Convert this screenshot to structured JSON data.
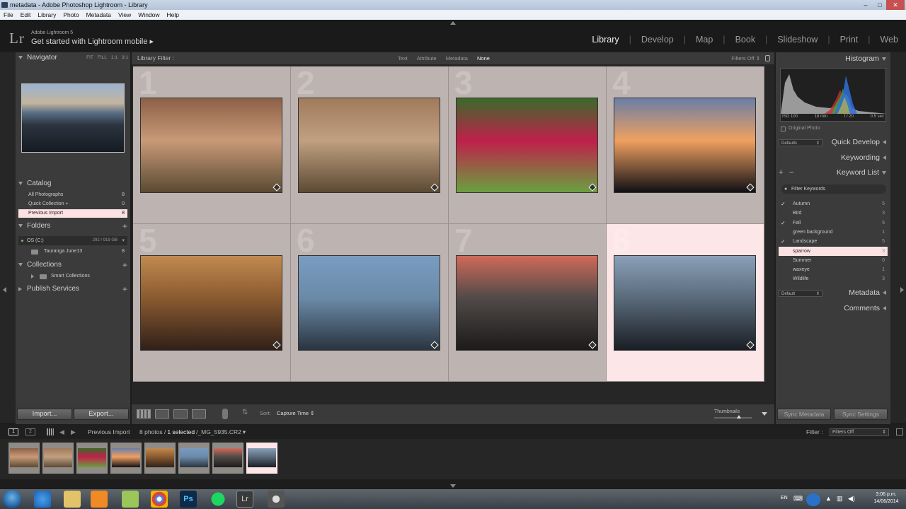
{
  "window": {
    "title": "metadata - Adobe Photoshop Lightroom - Library"
  },
  "menu": [
    "File",
    "Edit",
    "Library",
    "Photo",
    "Metadata",
    "View",
    "Window",
    "Help"
  ],
  "identity": {
    "logo": "Lr",
    "version": "Adobe Lightroom 5",
    "mobile": "Get started with Lightroom mobile"
  },
  "modules": [
    "Library",
    "Develop",
    "Map",
    "Book",
    "Slideshow",
    "Print",
    "Web"
  ],
  "active_module": "Library",
  "navigator": {
    "title": "Navigator",
    "options": [
      "FIT",
      "FILL",
      "1:1",
      "3:1"
    ]
  },
  "catalog": {
    "title": "Catalog",
    "items": [
      {
        "label": "All Photographs",
        "count": "8"
      },
      {
        "label": "Quick Collection +",
        "count": "0"
      },
      {
        "label": "Previous Import",
        "count": "8"
      }
    ]
  },
  "folders": {
    "title": "Folders",
    "drive": "OS (C:)",
    "drive_size": "292 / 919 GB",
    "folder": "Tauranga June13",
    "folder_count": "8"
  },
  "collections": {
    "title": "Collections",
    "item": "Smart Collections"
  },
  "publish": {
    "title": "Publish Services"
  },
  "filter_bar": {
    "label": "Library Filter :",
    "options": [
      "Text",
      "Attribute",
      "Metadata",
      "None"
    ],
    "active": "None",
    "filters_off": "Filters Off"
  },
  "grid": {
    "cells": [
      {
        "num": "1",
        "colors": [
          "#8c6048",
          "#c89a78",
          "#5a4a32"
        ]
      },
      {
        "num": "2",
        "colors": [
          "#a07a5c",
          "#c0a080",
          "#5c4a34"
        ]
      },
      {
        "num": "3",
        "colors": [
          "#3a6a2a",
          "#c0204a",
          "#6aa040"
        ]
      },
      {
        "num": "4",
        "colors": [
          "#6a7ea6",
          "#f0a060",
          "#101014"
        ]
      },
      {
        "num": "5",
        "colors": [
          "#c08a50",
          "#8a5a30",
          "#302018"
        ]
      },
      {
        "num": "6",
        "colors": [
          "#7a9cc0",
          "#6a8aa8",
          "#2a3440"
        ]
      },
      {
        "num": "7",
        "colors": [
          "#d06a5a",
          "#504a48",
          "#1c1a1a"
        ]
      },
      {
        "num": "8",
        "colors": [
          "#8aa0b8",
          "#5a6a7a",
          "#1a1e24"
        ]
      }
    ],
    "selected": 7
  },
  "toolbar": {
    "import": "Import...",
    "export": "Export...",
    "sort_label": "Sort:",
    "sort_value": "Capture Time",
    "thumbnails": "Thumbnails"
  },
  "histogram": {
    "title": "Histogram",
    "iso": "ISO 100",
    "focal": "18 mm",
    "aperture": "f / 20",
    "shutter": "0.5 sec",
    "original": "Original Photo"
  },
  "quick_develop": {
    "title": "Quick Develop",
    "preset": "Defaults"
  },
  "keywording": {
    "title": "Keywording"
  },
  "keyword_list": {
    "title": "Keyword List",
    "filter": "Filter Keywords",
    "items": [
      {
        "label": "Autumn",
        "count": "5",
        "check": "✓"
      },
      {
        "label": "Bird",
        "count": "3",
        "check": ""
      },
      {
        "label": "Fall",
        "count": "5",
        "check": "✓"
      },
      {
        "label": "green background",
        "count": "1",
        "check": ""
      },
      {
        "label": "Landscape",
        "count": "5",
        "check": "✓"
      },
      {
        "label": "sparrow",
        "count": "3",
        "check": ""
      },
      {
        "label": "Summer",
        "count": "0",
        "check": ""
      },
      {
        "label": "waxeye",
        "count": "1",
        "check": ""
      },
      {
        "label": "Wildlife",
        "count": "3",
        "check": ""
      }
    ],
    "selected": 5
  },
  "metadata": {
    "title": "Metadata",
    "preset": "Default"
  },
  "comments": {
    "title": "Comments"
  },
  "sync": {
    "metadata": "Sync Metadata",
    "settings": "Sync Settings"
  },
  "filmstrip": {
    "source": "Previous Import",
    "count": "8 photos /",
    "selected": "1 selected",
    "file": "/_MG_5935.CR2",
    "filter_label": "Filter :",
    "filter_value": "Filters Off",
    "page1": "1",
    "page2": "2"
  },
  "taskbar": {
    "lang": "EN",
    "time": "3:06 p.m.",
    "date": "14/06/2014"
  }
}
